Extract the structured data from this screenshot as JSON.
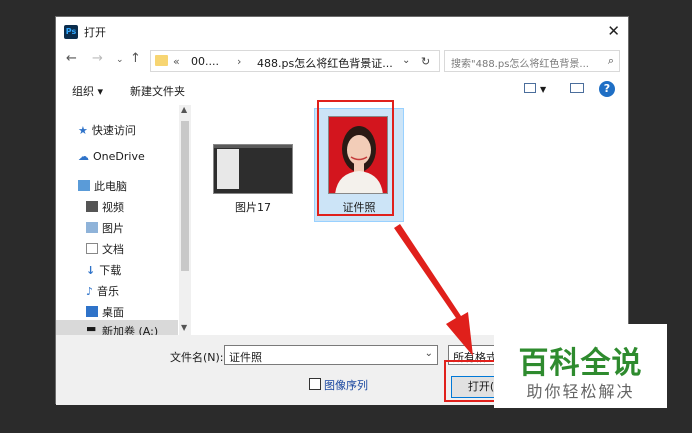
{
  "window": {
    "title": "打开",
    "app_icon": "Ps"
  },
  "address_bar": {
    "overflow": "«",
    "crumb1": "00....",
    "sep": "›",
    "crumb2": "488.ps怎么将红色背景证..."
  },
  "search": {
    "placeholder": "搜索\"488.ps怎么将红色背景..."
  },
  "toolbar": {
    "organize": "组织 ▾",
    "new_folder": "新建文件夹"
  },
  "nav_pane": {
    "quick_access": "快速访问",
    "onedrive": "OneDrive",
    "this_pc": "此电脑",
    "videos": "视频",
    "pictures": "图片",
    "documents": "文档",
    "downloads": "下载",
    "music": "音乐",
    "desktop": "桌面",
    "new_volume": "新加卷 (A:)"
  },
  "files": [
    {
      "name": "图片17"
    },
    {
      "name": "证件照",
      "selected": true
    }
  ],
  "bottom": {
    "filename_label": "文件名(N):",
    "filename_value": "证件照",
    "filetype": "所有格式",
    "sequence_label": "图像序列",
    "open_label": "打开("
  },
  "watermark": {
    "main": "百科全说",
    "sub": "助你轻松解决"
  },
  "colors": {
    "highlight_red": "#e0201b",
    "selection": "#cce4f7",
    "accent": "#0078d7"
  }
}
